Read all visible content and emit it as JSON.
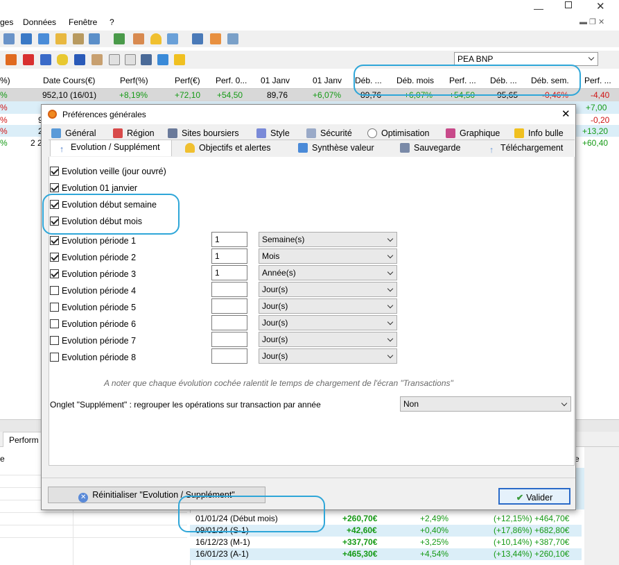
{
  "menu": {
    "item1": "ges",
    "item2": "Données",
    "item3": "Fenêtre",
    "item4": "?"
  },
  "account": {
    "value": "PEA BNP"
  },
  "grid": {
    "headers": {
      "h0": "%)",
      "h1": "Date Cours(€)",
      "h2": "Perf(%)",
      "h3": "Perf(€)",
      "h4": "Perf. 0...",
      "h5": "01 Janv",
      "h6": "01 Janv",
      "h7": "Déb. ...",
      "h8": "Déb. mois",
      "h9": "Perf. ...",
      "h10": "Déb. ...",
      "h11": "Déb. sem.",
      "h12": "Perf. ..."
    },
    "row1": {
      "c0": "%",
      "c1": "952,10 (16/01)",
      "c2": "+8,19%",
      "c3": "+72,10",
      "c4": "+54,50",
      "c5": "89,76",
      "c6": "+6,07%",
      "c7": "89,76",
      "c8": "+6,07%",
      "c9": "+54,50",
      "c10": "95,65",
      "c11": "-0,46%",
      "c12": "-4,40"
    },
    "left_frag": {
      "r2": "%",
      "r3": "%",
      "r4": "%",
      "r5": "%",
      "n3": "9",
      "n4": "2",
      "n5": "2 2"
    },
    "right_col": {
      "r2": "+7,00",
      "r3": "-0,20",
      "r4": "+13,20",
      "r5": "+60,40"
    }
  },
  "bottom": {
    "tab": "Perform",
    "col_e": "e",
    "rows": [
      {
        "label": "01/01/24 (Début mois)",
        "amount": "+260,70€",
        "pct": "+2,49%",
        "detail": "(+12,15%) +464,70€"
      },
      {
        "label": "09/01/24 (S-1)",
        "amount": "+42,60€",
        "pct": "+0,40%",
        "detail": "(+17,86%) +682,80€"
      },
      {
        "label": "16/12/23 (M-1)",
        "amount": "+337,70€",
        "pct": "+3,25%",
        "detail": "(+10,14%) +387,70€"
      },
      {
        "label": "16/01/23 (A-1)",
        "amount": "+465,30€",
        "pct": "+4,54%",
        "detail": "(+13,44%) +260,10€"
      }
    ]
  },
  "dialog": {
    "title": "Préférences générales",
    "tabs_row1": [
      "Général",
      "Région",
      "Sites boursiers",
      "Style",
      "Sécurité",
      "Optimisation",
      "Graphique",
      "Info bulle"
    ],
    "tabs_row2": [
      "Evolution / Supplément",
      "Objectifs et alertes",
      "Synthèse valeur",
      "Sauvegarde",
      "Téléchargement"
    ],
    "checks": [
      {
        "label": "Evolution veille (jour ouvré)",
        "checked": true
      },
      {
        "label": "Evolution 01 janvier",
        "checked": true
      },
      {
        "label": "Evolution début semaine",
        "checked": true
      },
      {
        "label": "Evolution début mois",
        "checked": true
      }
    ],
    "periods": [
      {
        "label": "Evolution période 1",
        "checked": true,
        "value": "1",
        "unit": "Semaine(s)"
      },
      {
        "label": "Evolution période 2",
        "checked": true,
        "value": "1",
        "unit": "Mois"
      },
      {
        "label": "Evolution période 3",
        "checked": true,
        "value": "1",
        "unit": "Année(s)"
      },
      {
        "label": "Evolution période 4",
        "checked": false,
        "value": "",
        "unit": "Jour(s)"
      },
      {
        "label": "Evolution période 5",
        "checked": false,
        "value": "",
        "unit": "Jour(s)"
      },
      {
        "label": "Evolution période 6",
        "checked": false,
        "value": "",
        "unit": "Jour(s)"
      },
      {
        "label": "Evolution période 7",
        "checked": false,
        "value": "",
        "unit": "Jour(s)"
      },
      {
        "label": "Evolution période 8",
        "checked": false,
        "value": "",
        "unit": "Jour(s)"
      }
    ],
    "note": "A noter que chaque évolution cochée ralentit le temps de chargement de l'écran \"Transactions\"",
    "onglet_label": "Onglet \"Supplément\" : regrouper les opérations sur transaction par année",
    "onglet_value": "Non",
    "reset_label": "Réinitialiser \"Evolution / Supplément\"",
    "validate_label": "Valider"
  },
  "colors": {
    "highlight": "#2ea6d8",
    "positive": "#159a15",
    "negative": "#d01414"
  }
}
